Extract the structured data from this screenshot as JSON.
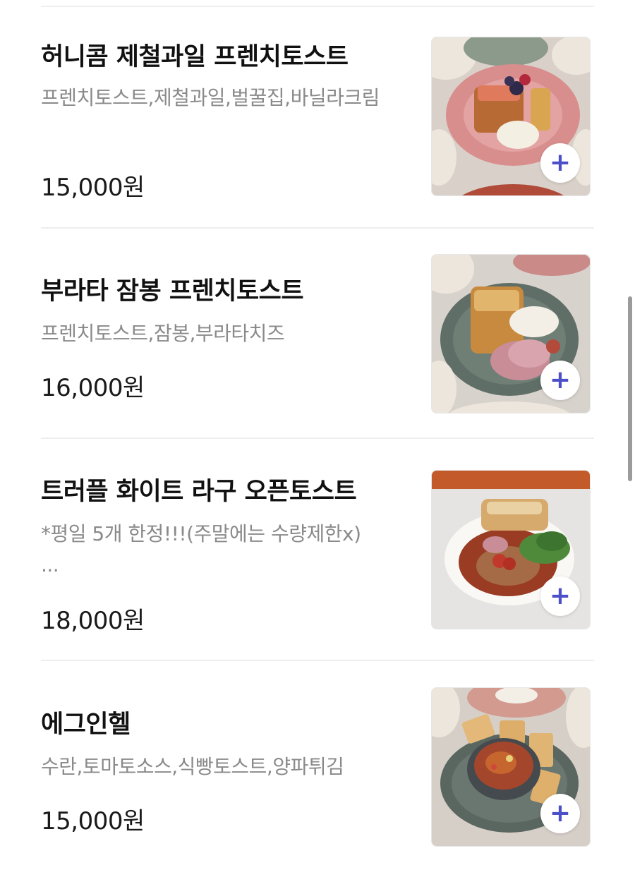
{
  "menu": {
    "items": [
      {
        "name": "허니콤 제철과일 프렌치토스트",
        "description": "프렌치토스트,제철과일,벌꿀집,바닐라크림",
        "price": "15,000원",
        "add_icon": "plus-icon"
      },
      {
        "name": "부라타 잠봉 프렌치토스트",
        "description": "프렌치토스트,잠봉,부라타치즈",
        "price": "16,000원",
        "add_icon": "plus-icon"
      },
      {
        "name": "트러플 화이트 라구 오픈토스트",
        "description": "*평일 5개 한정!!!(주말에는 수량제한x)",
        "description_more": "...",
        "price": "18,000원",
        "add_icon": "plus-icon"
      },
      {
        "name": "에그인헬",
        "description": "수란,토마토소스,식빵토스트,양파튀김",
        "price": "15,000원",
        "add_icon": "plus-icon"
      }
    ]
  },
  "colors": {
    "accent": "#4b4fc8",
    "text_primary": "#111111",
    "text_secondary": "#8a8a8a",
    "divider": "#eeeeee"
  }
}
